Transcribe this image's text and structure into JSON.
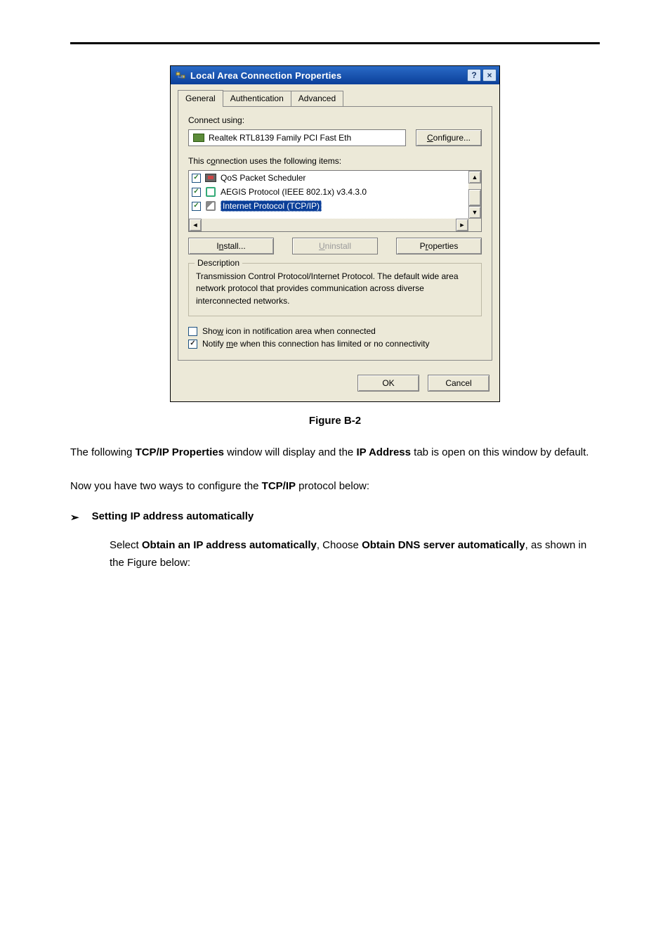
{
  "dialog": {
    "title": "Local Area Connection    Properties",
    "tabs": {
      "general": "General",
      "auth": "Authentication",
      "advanced": "Advanced"
    },
    "connect_using_label": "Connect using:",
    "adapter": "Realtek RTL8139 Family PCI Fast Eth",
    "configure": "Configure...",
    "configure_ul": "C",
    "items_label_pre": "This c",
    "items_label_ul": "o",
    "items_label_post": "nnection uses the following items:",
    "items": [
      {
        "name": "QoS Packet Scheduler",
        "checked": true,
        "icon": "qos-icon",
        "selected": false
      },
      {
        "name": "AEGIS Protocol (IEEE 802.1x) v3.4.3.0",
        "checked": true,
        "icon": "aegis-icon",
        "selected": false
      },
      {
        "name": "Internet Protocol (TCP/IP)",
        "checked": true,
        "icon": "tcpip-icon",
        "selected": true
      }
    ],
    "install_pre": "I",
    "install_ul": "n",
    "install_post": "stall...",
    "uninstall_pre": "",
    "uninstall_ul": "U",
    "uninstall_post": "ninstall",
    "properties_pre": "P",
    "properties_ul": "r",
    "properties_post": "operties",
    "desc_legend": "Description",
    "desc_text": "Transmission Control Protocol/Internet Protocol. The default wide area network protocol that provides communication across diverse interconnected networks.",
    "show_pre": "Sho",
    "show_ul": "w",
    "show_post": " icon in notification area when connected",
    "notify_pre": "Notify ",
    "notify_ul": "m",
    "notify_post": "e when this connection has limited or no connectivity",
    "show_checked": false,
    "notify_checked": true,
    "ok": "OK",
    "cancel": "Cancel"
  },
  "caption": "Figure B-2",
  "body": {
    "p1_a": "The following ",
    "p1_b": "TCP/IP Properties",
    "p1_c": " window will display and the ",
    "p1_d": "IP Address",
    "p1_e": " tab is open on this window by default.",
    "p2_a": "Now you have two ways to configure the ",
    "p2_b": "TCP/IP",
    "p2_c": " protocol below:",
    "bullet": "Setting IP address automatically",
    "sel_a": "Select ",
    "sel_b": "Obtain an IP address automatically",
    "sel_c": ", Choose ",
    "sel_d": "Obtain DNS server automatically",
    "sel_e": ", as shown in the Figure below:"
  }
}
